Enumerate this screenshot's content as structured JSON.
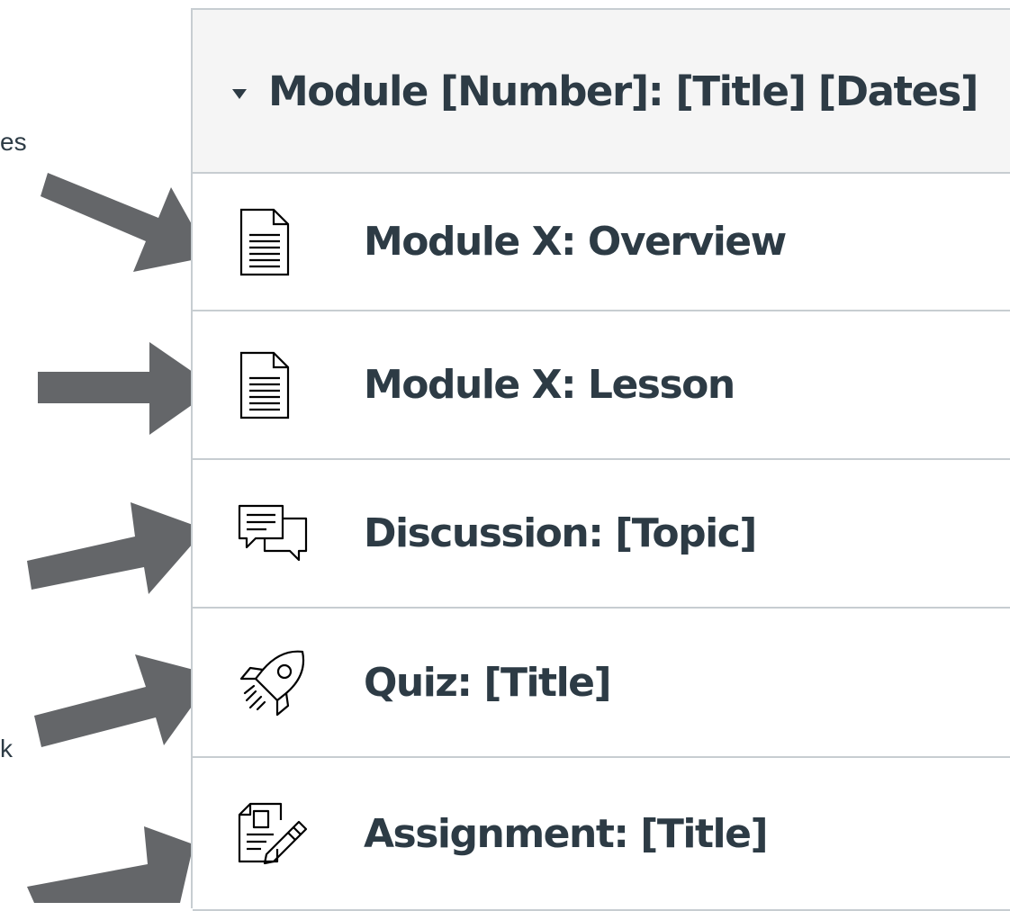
{
  "annotation_fragments": [
    "es",
    "k"
  ],
  "module": {
    "header_title": "Module [Number]: [Title] [Dates]",
    "expanded": true
  },
  "items": [
    {
      "label": "Module X: Overview",
      "icon": "document-icon"
    },
    {
      "label": "Module X: Lesson",
      "icon": "document-icon"
    },
    {
      "label": "Discussion: [Topic]",
      "icon": "discussion-icon"
    },
    {
      "label": "Quiz: [Title]",
      "icon": "quiz-rocket-icon"
    },
    {
      "label": "Assignment: [Title]",
      "icon": "assignment-icon"
    }
  ],
  "colors": {
    "text": "#2d3b45",
    "arrow": "#646669",
    "border": "#c7cdd1",
    "header_bg": "#f5f5f5"
  }
}
